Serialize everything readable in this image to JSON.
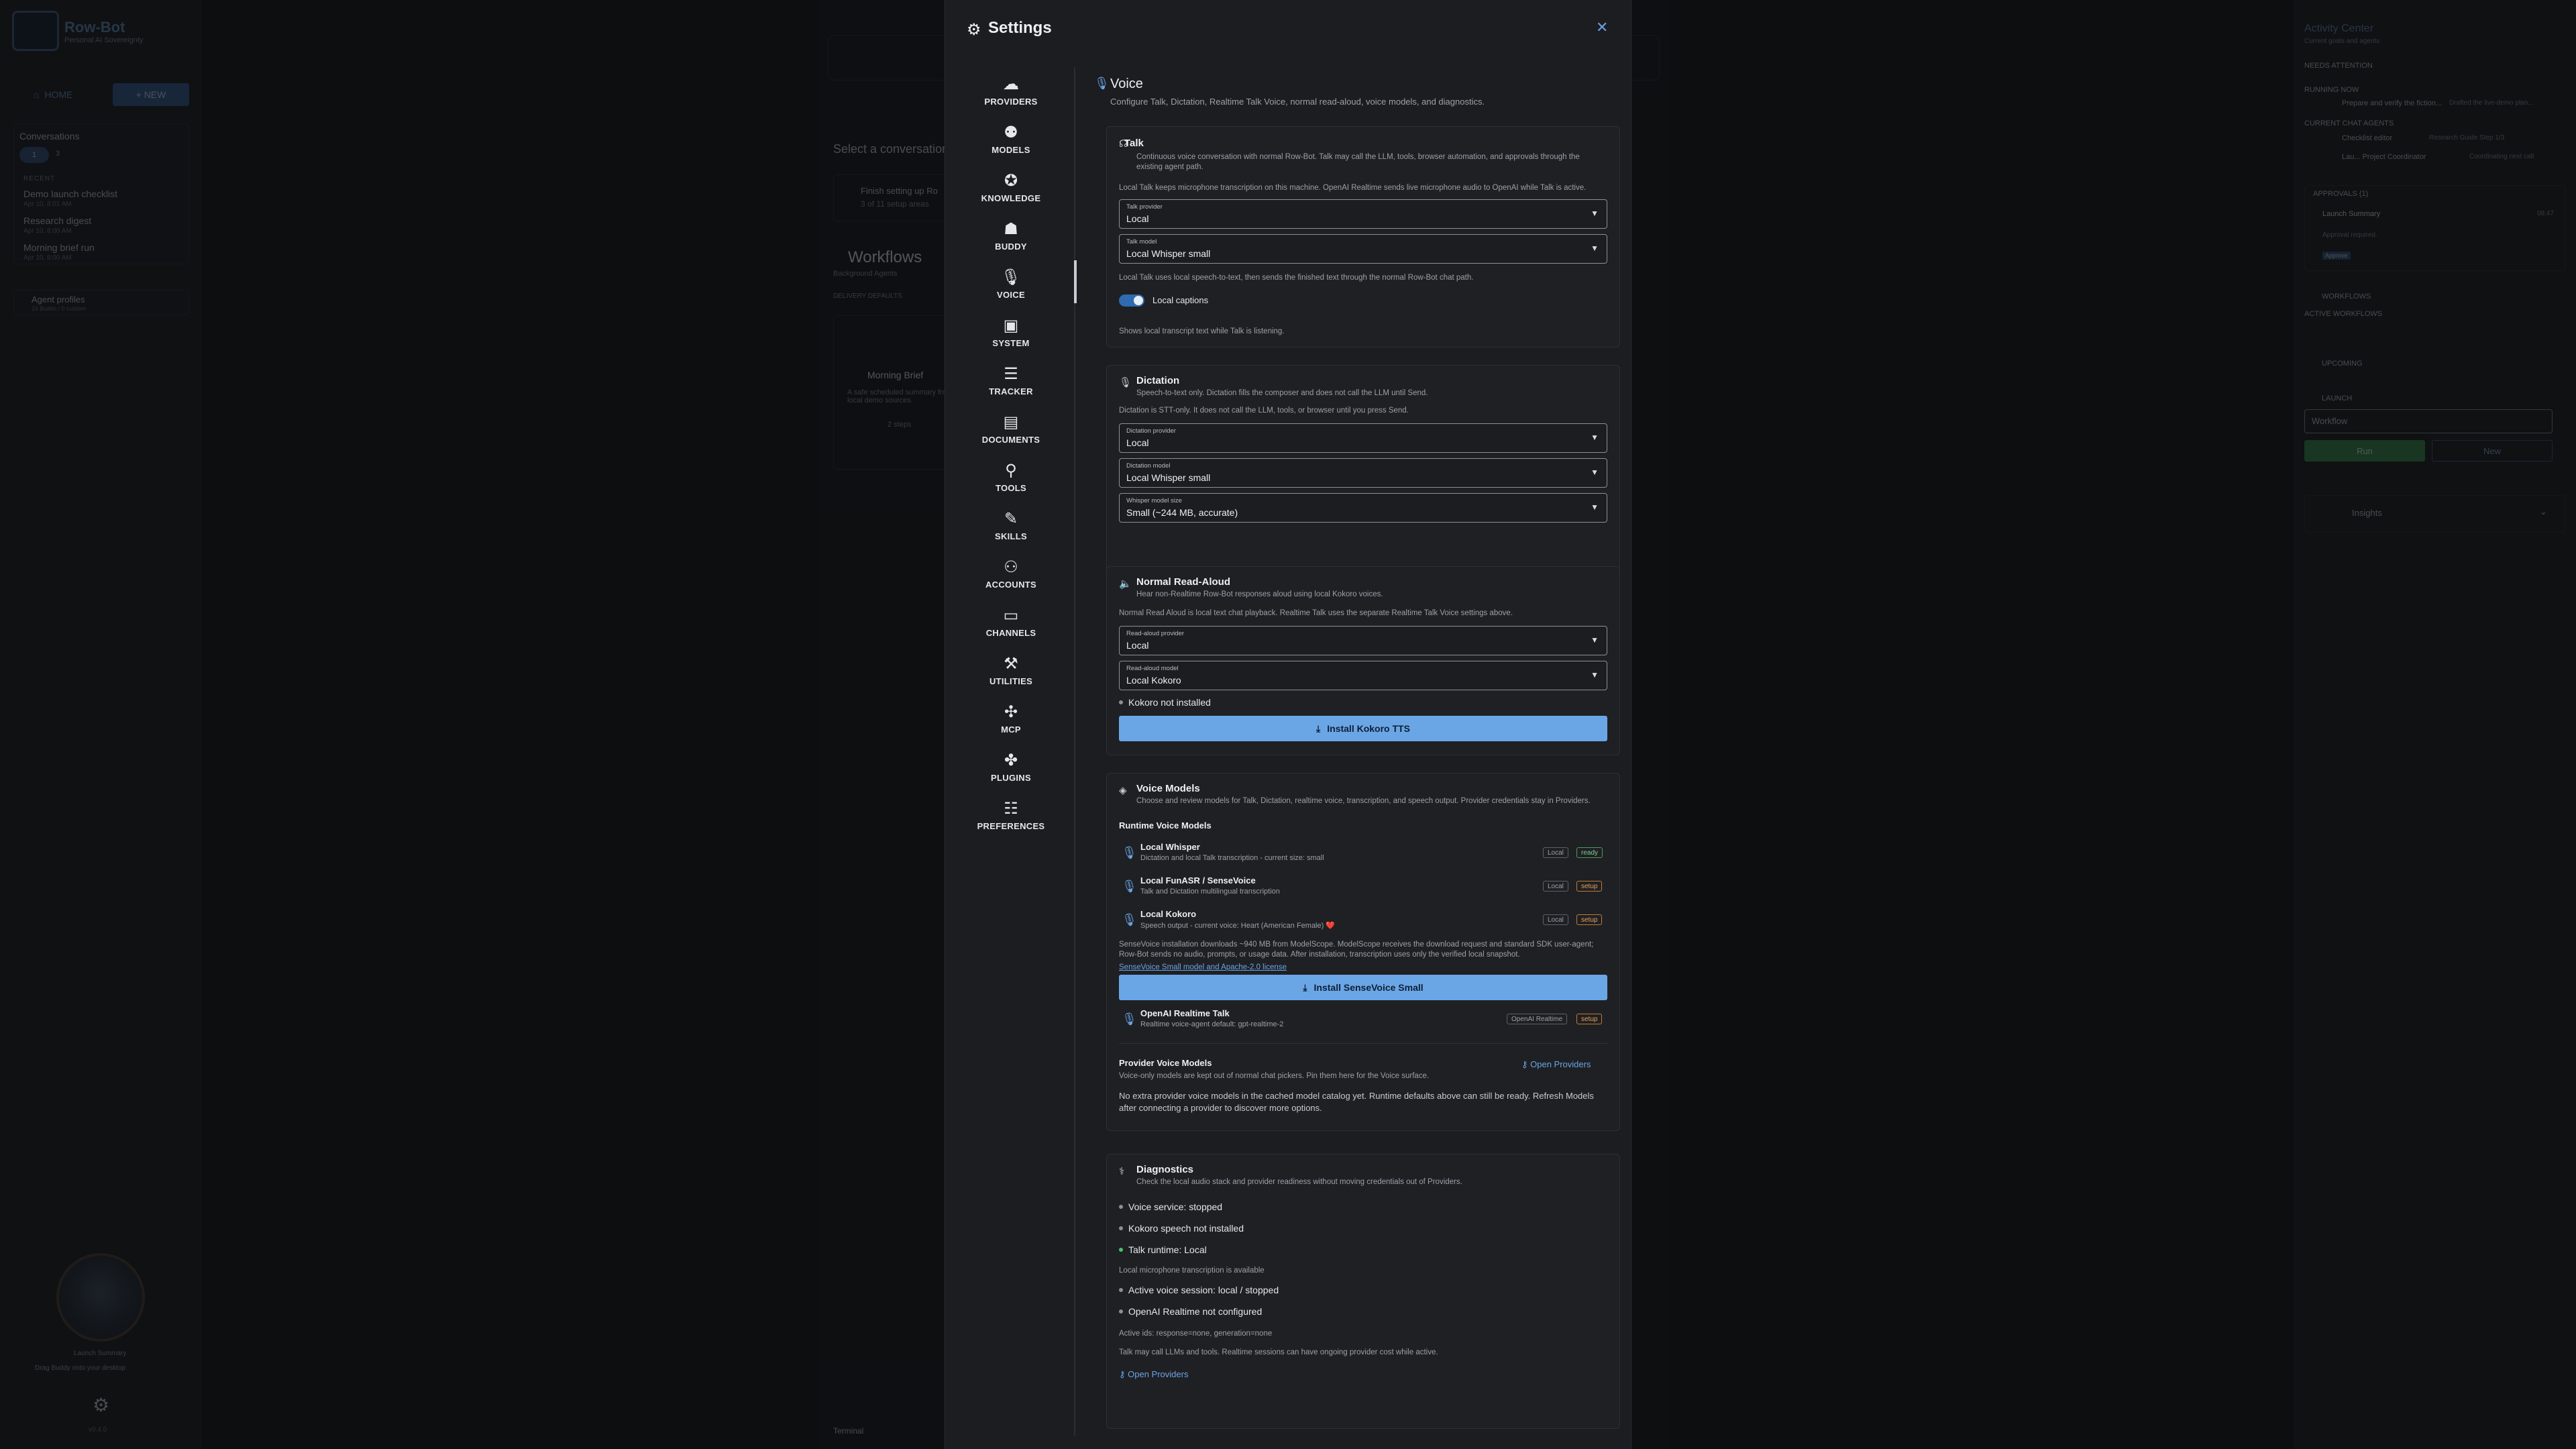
{
  "app": {
    "brand": "Row-Bot",
    "brand_sub": "Personal AI Sovereignty"
  },
  "left": {
    "home": "HOME",
    "new": "+ NEW",
    "conversations_title": "Conversations",
    "chip1": "1",
    "chip2": "3",
    "recent": "RECENT",
    "items": [
      {
        "title": "Demo launch checklist",
        "date": "Apr 10, 8:01 AM"
      },
      {
        "title": "Research digest",
        "date": "Apr 10, 8:00 AM"
      },
      {
        "title": "Morning brief run",
        "date": "Apr 10, 8:00 AM"
      }
    ],
    "agent_profiles": "Agent profiles",
    "agent_sub": "16 Builtin / 0 custom",
    "avatar_caption": "Launch Summary",
    "drag_hint": "Drag Buddy onto your desktop",
    "version": "v0.4.0"
  },
  "center": {
    "select_conversation": "Select a conversation",
    "setup_title": "Finish setting up Ro",
    "setup_sub": "3 of 11 setup areas",
    "workflows_title": "Workflows",
    "workflows_sub": "Background Agents",
    "delivery_defaults": "DELIVERY DEFAULTS",
    "wf_card_title": "Morning Brief",
    "wf_card_desc": "A safe scheduled summary from local demo sources.",
    "wf_steps": "2 steps",
    "terminal": "Terminal"
  },
  "right": {
    "activity_title": "Activity Center",
    "activity_sub": "Current goals and agents",
    "needs_attention": "NEEDS ATTENTION",
    "running_now": "RUNNING NOW",
    "running_item": "Prepare and verify the fiction...",
    "running_item_tail": "Drafted the live-demo plan...",
    "current_chat_agents": "CURRENT CHAT AGENTS",
    "agent1": "Checklist editor",
    "agent1_tail": "Research Guide  Step 1/3",
    "agent2": "Lau...  Project Coordinator",
    "agent2_tail": "Coordinating next call",
    "approvals": "APPROVALS (1)",
    "approval_title": "Launch Summary",
    "approval_time": "08:47",
    "approval_body": "Approval required.",
    "approve": "Approve",
    "workflows": "WORKFLOWS",
    "active_workflows": "ACTIVE WORKFLOWS",
    "upcoming": "UPCOMING",
    "launch": "LAUNCH",
    "launch_select": "Workflow",
    "run": "Run",
    "new": "New",
    "insights": "Insights"
  },
  "settings": {
    "title": "Settings",
    "nav": [
      "PROVIDERS",
      "MODELS",
      "KNOWLEDGE",
      "BUDDY",
      "VOICE",
      "SYSTEM",
      "TRACKER",
      "DOCUMENTS",
      "TOOLS",
      "SKILLS",
      "ACCOUNTS",
      "CHANNELS",
      "UTILITIES",
      "MCP",
      "PLUGINS",
      "PREFERENCES"
    ],
    "voice_title": "Voice",
    "voice_sub": "Configure Talk, Dictation, Realtime Talk Voice, normal read-aloud, voice models, and diagnostics.",
    "talk": {
      "title": "Talk",
      "desc": "Continuous voice conversation with normal Row-Bot. Talk may call the LLM, tools, browser automation, and approvals through the existing agent path.",
      "note1": "Local Talk keeps microphone transcription on this machine. OpenAI Realtime sends live microphone audio to OpenAI while Talk is active.",
      "provider_label": "Talk provider",
      "provider_value": "Local",
      "model_label": "Talk model",
      "model_value": "Local Whisper small",
      "note2": "Local Talk uses local speech-to-text, then sends the finished text through the normal Row-Bot chat path.",
      "captions": "Local captions",
      "captions_note": "Shows local transcript text while Talk is listening."
    },
    "dictation": {
      "title": "Dictation",
      "desc": "Speech-to-text only. Dictation fills the composer and does not call the LLM until Send.",
      "note": "Dictation is STT-only. It does not call the LLM, tools, or browser until you press Send.",
      "provider_label": "Dictation provider",
      "provider_value": "Local",
      "model_label": "Dictation model",
      "model_value": "Local Whisper small",
      "size_label": "Whisper model size",
      "size_value": "Small (~244 MB, accurate)"
    },
    "readaloud": {
      "title": "Normal Read-Aloud",
      "desc": "Hear non-Realtime Row-Bot responses aloud using local Kokoro voices.",
      "note": "Normal Read Aloud is local text chat playback. Realtime Talk uses the separate Realtime Talk Voice settings above.",
      "provider_label": "Read-aloud provider",
      "provider_value": "Local",
      "model_label": "Read-aloud model",
      "model_value": "Local Kokoro",
      "status": "Kokoro not installed",
      "install": "Install Kokoro TTS"
    },
    "voice_models": {
      "title": "Voice Models",
      "desc": "Choose and review models for Talk, Dictation, realtime voice, transcription, and speech output. Provider credentials stay in Providers.",
      "runtime_title": "Runtime Voice Models",
      "rows": [
        {
          "name": "Local Whisper",
          "desc": "Dictation and local Talk transcription - current size: small",
          "tag1": "Local",
          "tag2": "ready"
        },
        {
          "name": "Local FunASR / SenseVoice",
          "desc": "Talk and Dictation multilingual transcription",
          "tag1": "Local",
          "tag2": "setup"
        },
        {
          "name": "Local Kokoro",
          "desc": "Speech output - current voice: Heart (American Female) ❤️",
          "tag1": "Local",
          "tag2": "setup"
        }
      ],
      "sense_note": "SenseVoice installation downloads ~940 MB from ModelScope. ModelScope receives the download request and standard SDK user-agent; Row-Bot sends no audio, prompts, or usage data. After installation, transcription uses only the verified local snapshot.",
      "sense_link": "SenseVoice Small model and Apache-2.0 license",
      "install_sense": "Install SenseVoice Small",
      "openai": {
        "name": "OpenAI Realtime Talk",
        "desc": "Realtime voice-agent default: gpt-realtime-2",
        "tag1": "OpenAI Realtime",
        "tag2": "setup"
      },
      "provider_title": "Provider Voice Models",
      "provider_desc": "Voice-only models are kept out of normal chat pickers. Pin them here for the Voice surface.",
      "open_providers": "Open Providers",
      "provider_note": "No extra provider voice models in the cached model catalog yet. Runtime defaults above can still be ready. Refresh Models after connecting a provider to discover more options."
    },
    "diagnostics": {
      "title": "Diagnostics",
      "desc": "Check the local audio stack and provider readiness without moving credentials out of Providers.",
      "lines": [
        {
          "text": "Voice service: stopped",
          "color": "#8a9099"
        },
        {
          "text": "Kokoro speech not installed",
          "color": "#8a9099"
        },
        {
          "text": "Talk runtime: Local",
          "color": "#4fbf6a"
        }
      ],
      "mic_note": "Local microphone transcription is available",
      "lines2": [
        {
          "text": "Active voice session: local / stopped",
          "color": "#8a9099"
        },
        {
          "text": "OpenAI Realtime not configured",
          "color": "#8a9099"
        }
      ],
      "ids_note": "Active ids: response=none, generation=none",
      "talk_note": "Talk may call LLMs and tools. Realtime sessions can have ongoing provider cost while active.",
      "open_providers": "Open Providers"
    }
  }
}
